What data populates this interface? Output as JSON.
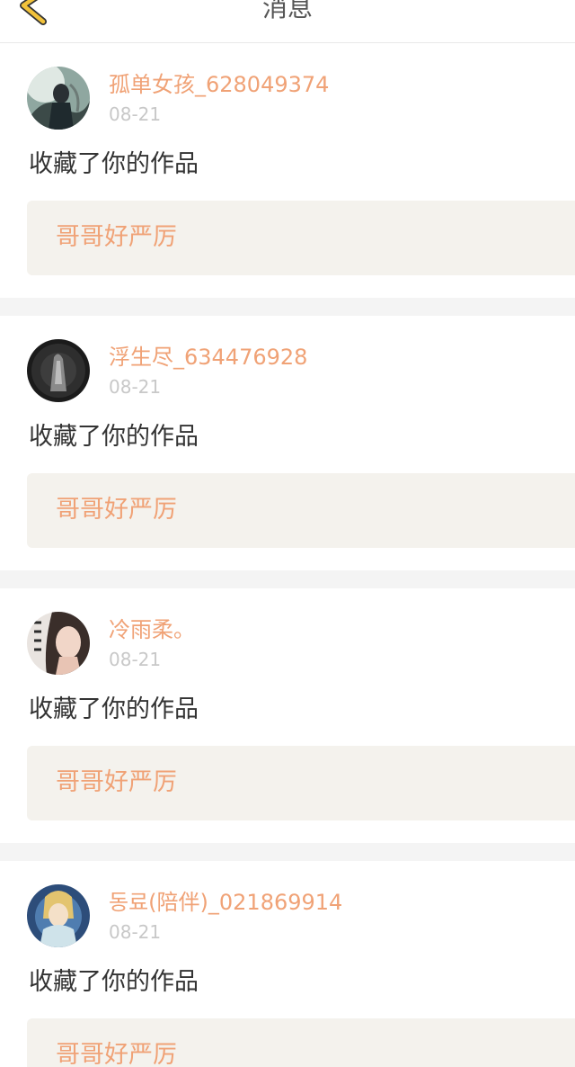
{
  "header": {
    "title": "消息",
    "back_icon": "chevron-left-icon",
    "accent_color": "#f2c23a"
  },
  "colors": {
    "username": "#f0a276",
    "timestamp": "#c8c8c8",
    "work_box_bg": "#f4f2ed"
  },
  "messages": [
    {
      "username": "孤单女孩_628049374",
      "time": "08-21",
      "action": "收藏了你的作品",
      "work_title": "哥哥好严厉"
    },
    {
      "username": "浮生尽_634476928",
      "time": "08-21",
      "action": "收藏了你的作品",
      "work_title": "哥哥好严厉"
    },
    {
      "username": "冷雨柔。",
      "time": "08-21",
      "action": "收藏了你的作品",
      "work_title": "哥哥好严厉"
    },
    {
      "username": "동료(陪伴)_021869914",
      "time": "08-21",
      "action": "收藏了你的作品",
      "work_title": "哥哥好严厉"
    }
  ]
}
